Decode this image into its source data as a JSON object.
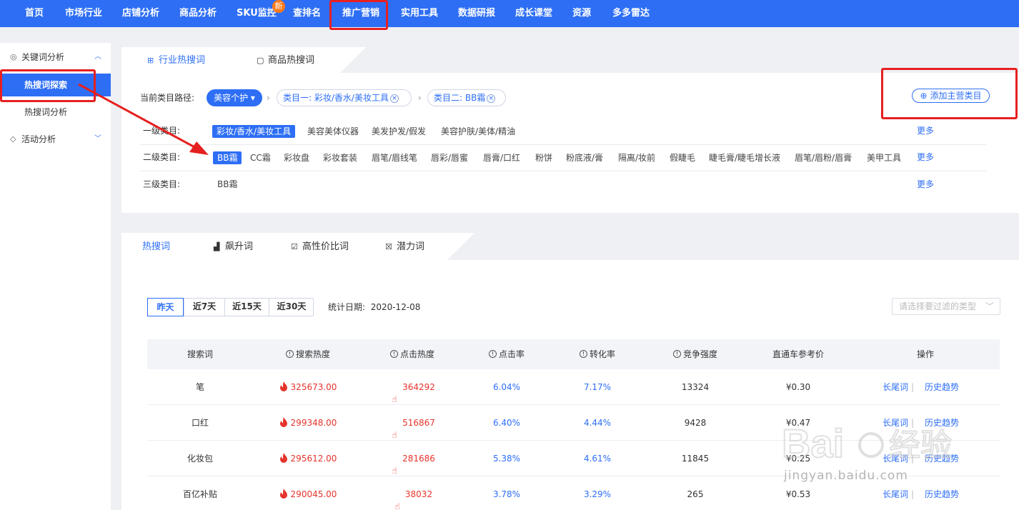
{
  "nav": {
    "items": [
      "首页",
      "市场行业",
      "店铺分析",
      "商品分析",
      "SKU监控",
      "查排名",
      "推广营销",
      "实用工具",
      "数据研报",
      "成长课堂",
      "资源",
      "多多雷达"
    ],
    "new_badge": "新",
    "active": "推广营销"
  },
  "sidebar": {
    "group1": "关键词分析",
    "item_active": "热搜词探索",
    "item2": "热搜词分析",
    "group2": "活动分析"
  },
  "tabs1": [
    "行业热搜词",
    "商品热搜词"
  ],
  "path": {
    "label": "当前类目路径:",
    "root": "美容个护",
    "level1": "类目一: 彩妆/香水/美妆工具",
    "level2": "类目二: BB霜",
    "add_button": "添加主营类目"
  },
  "rows": {
    "level1_label": "一级类目:",
    "level1_items": [
      "彩妆/香水/美妆工具",
      "美容美体仪器",
      "美发护发/假发",
      "美容护肤/美体/精油"
    ],
    "level2_label": "二级类目:",
    "level2_items": [
      "BB霜",
      "CC霜",
      "彩妆盘",
      "彩妆套装",
      "眉笔/眉线笔",
      "唇彩/唇蜜",
      "唇膏/口红",
      "粉饼",
      "粉底液/膏",
      "隔离/妆前",
      "假睫毛",
      "睫毛膏/睫毛增长液",
      "眉笔/眉粉/眉膏",
      "美甲工具"
    ],
    "level3_label": "三级类目:",
    "level3_items": [
      "BB霜"
    ],
    "more": "更多"
  },
  "tabs2": [
    "热搜词",
    "飙升词",
    "高性价比词",
    "潜力词"
  ],
  "date_range": {
    "buttons": [
      "昨天",
      "近7天",
      "近15天",
      "近30天"
    ],
    "selected": "昨天",
    "stat_label": "统计日期:",
    "stat_date": "2020-12-08"
  },
  "filter": {
    "placeholder": "请选择要过滤的类型"
  },
  "table": {
    "headers": [
      "搜索词",
      "搜索热度",
      "点击热度",
      "点击率",
      "转化率",
      "竞争强度",
      "直通车参考价",
      "操作"
    ],
    "rows": [
      {
        "keyword": "笔",
        "search_heat": "325673.00",
        "click_heat": "364292",
        "ctr": "6.04%",
        "cvr": "7.17%",
        "competition": "13324",
        "price": "¥0.30"
      },
      {
        "keyword": "口红",
        "search_heat": "299348.00",
        "click_heat": "516867",
        "ctr": "6.40%",
        "cvr": "4.44%",
        "competition": "9428",
        "price": "¥0.47"
      },
      {
        "keyword": "化妆包",
        "search_heat": "295612.00",
        "click_heat": "281686",
        "ctr": "5.38%",
        "cvr": "4.61%",
        "competition": "11845",
        "price": "¥0.25"
      },
      {
        "keyword": "百亿补贴",
        "search_heat": "290045.00",
        "click_heat": "38032",
        "ctr": "3.78%",
        "cvr": "3.29%",
        "competition": "265",
        "price": "¥0.53"
      }
    ],
    "op_long_tail": "长尾词",
    "op_history": "历史趋势"
  },
  "watermark": {
    "brand": "Bai",
    "brand2": "经验",
    "url": "jingyan.baidu.com"
  },
  "colors": {
    "primary": "#2d6ef5",
    "heat": "#e5342c",
    "badge": "#ff7a1a",
    "highlight": "#e62020"
  }
}
